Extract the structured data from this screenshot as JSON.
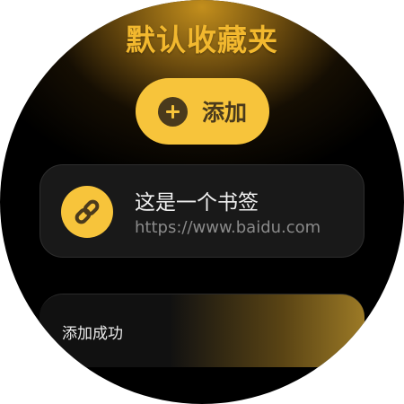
{
  "header": {
    "title": "默认收藏夹"
  },
  "add_button": {
    "label": "添加",
    "icon": "plus-circle-icon"
  },
  "bookmarks": [
    {
      "title": "这是一个书签",
      "url": "https://www.baidu.com",
      "icon": "link-icon"
    }
  ],
  "toast": {
    "message": "添加成功"
  },
  "colors": {
    "accent": "#f7c43b",
    "title": "#f2b82e",
    "background": "#000000",
    "card": "#191919",
    "icon_foreground": "#4a3a1c"
  }
}
